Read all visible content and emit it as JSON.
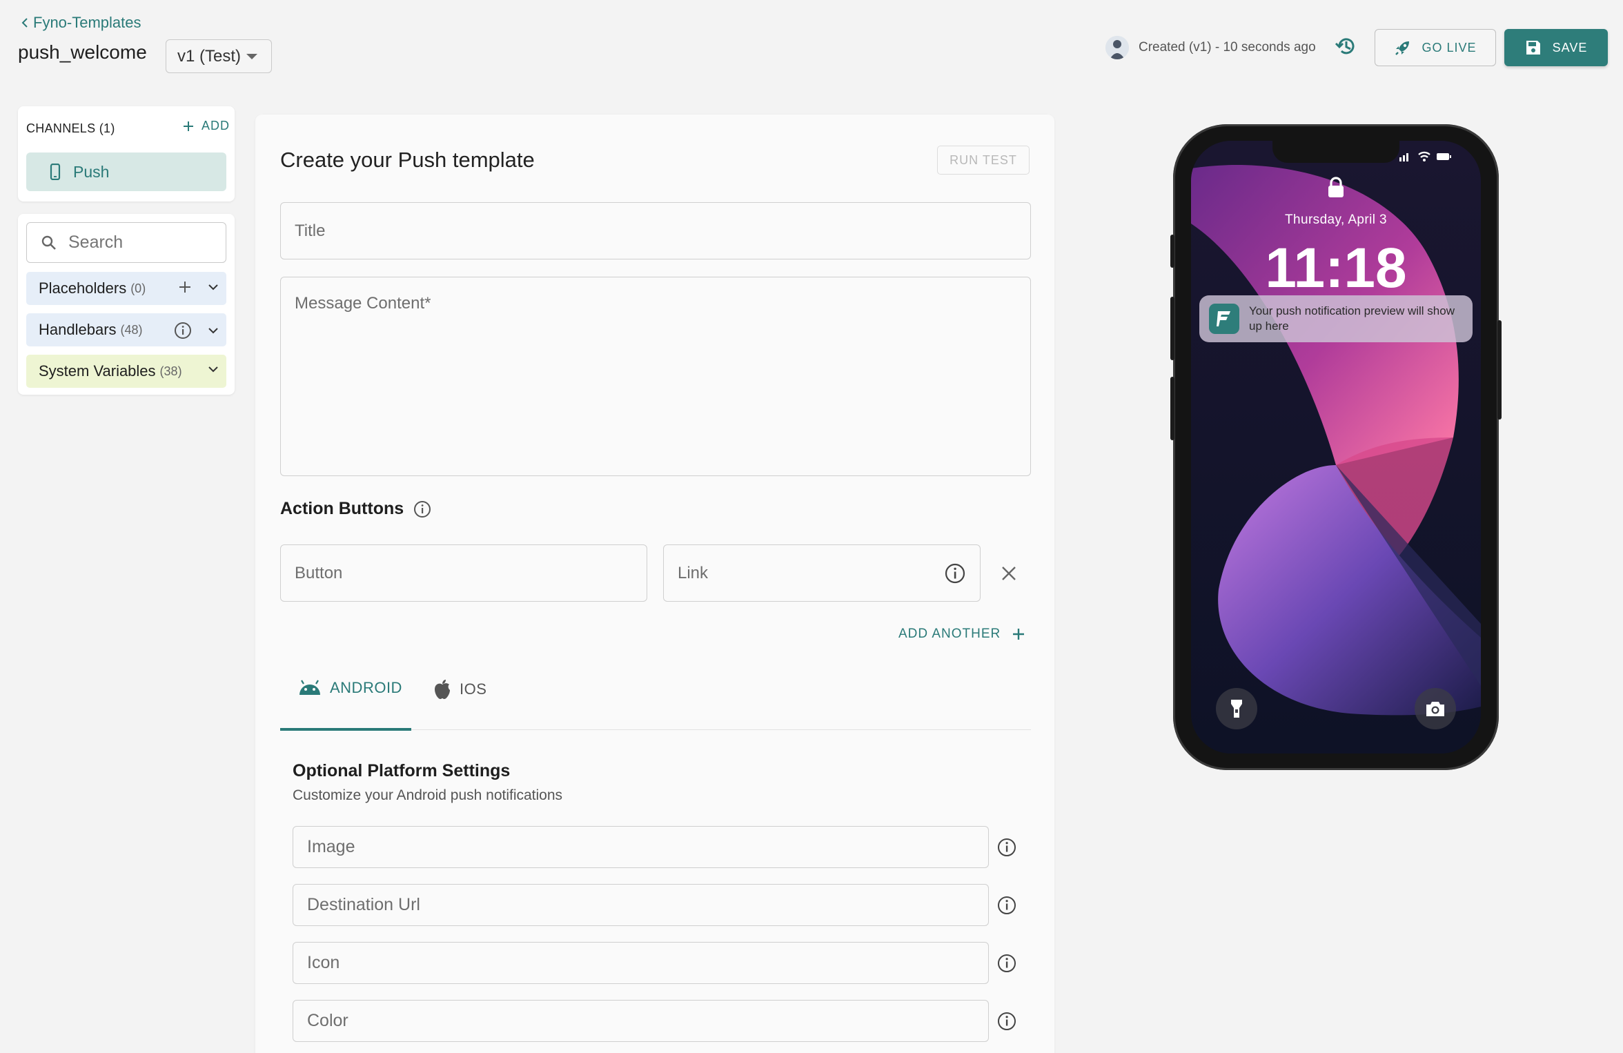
{
  "header": {
    "back_label": "Fyno-Templates",
    "title": "push_welcome",
    "version": "v1 (Test)",
    "status": "Created (v1) - 10 seconds ago",
    "go_live_label": "GO LIVE",
    "save_label": "SAVE"
  },
  "channels": {
    "header": "CHANNELS (1)",
    "add_label": "ADD",
    "items": [
      {
        "label": "Push",
        "icon": "phone-icon"
      }
    ]
  },
  "variables": {
    "search_placeholder": "Search",
    "rows": [
      {
        "label": "Placeholders",
        "count": "(0)"
      },
      {
        "label": "Handlebars",
        "count": "(48)"
      },
      {
        "label": "System Variables",
        "count": "(38)"
      }
    ]
  },
  "editor": {
    "title": "Create your Push template",
    "run_test_label": "RUN TEST",
    "title_placeholder": "Title",
    "message_placeholder": "Message Content*",
    "action_buttons_label": "Action Buttons",
    "button_placeholder": "Button",
    "link_placeholder": "Link",
    "add_another_label": "ADD ANOTHER",
    "tabs": [
      {
        "label": "ANDROID",
        "icon": "android-icon",
        "active": true
      },
      {
        "label": "IOS",
        "icon": "apple-icon",
        "active": false
      }
    ],
    "optional": {
      "title": "Optional Platform Settings",
      "subtitle": "Customize your Android push notifications",
      "fields": [
        "Image",
        "Destination Url",
        "Icon",
        "Color"
      ]
    }
  },
  "preview": {
    "date": "Thursday, April 3",
    "time": "11:18",
    "notification_text": "Your push notification preview will show up here"
  },
  "colors": {
    "accent": "#2a7a78",
    "save_bg": "#2e7d7a",
    "channel_active_bg": "#d7e8e5",
    "handlebars_bg": "#e6eef8",
    "system_vars_bg": "#eef5d3"
  }
}
